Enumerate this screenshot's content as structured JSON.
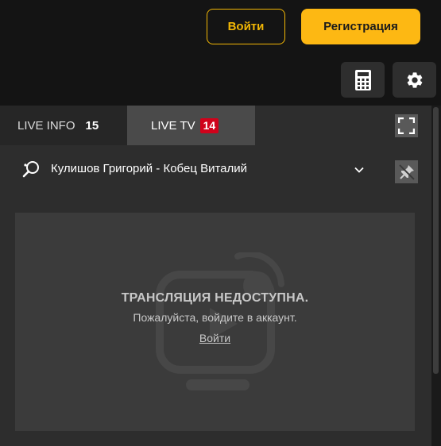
{
  "header": {
    "login_label": "Войти",
    "register_label": "Регистрация",
    "calculator_icon": "calculator-icon",
    "settings_icon": "gear-icon"
  },
  "tabs": {
    "live_info": {
      "label": "LIVE INFO",
      "count": "15"
    },
    "live_tv": {
      "label": "LIVE TV",
      "count": "14"
    },
    "expand_icon": "fullscreen-icon"
  },
  "match": {
    "title": "Кулишов Григорий - Кобец Виталий",
    "sport_icon": "table-tennis-icon",
    "pin_icon": "unpin-icon"
  },
  "stream": {
    "title": "ТРАНСЛЯЦИЯ НЕДОСТУПНА.",
    "subtitle": "Пожалуйста, войдите в аккаунт.",
    "link_label": "Войти",
    "background_icon": "tv-play-icon"
  },
  "colors": {
    "accent": "#fdb813",
    "badge_red": "#d0021b",
    "background": "#141414",
    "panel": "#2d2d2d"
  }
}
